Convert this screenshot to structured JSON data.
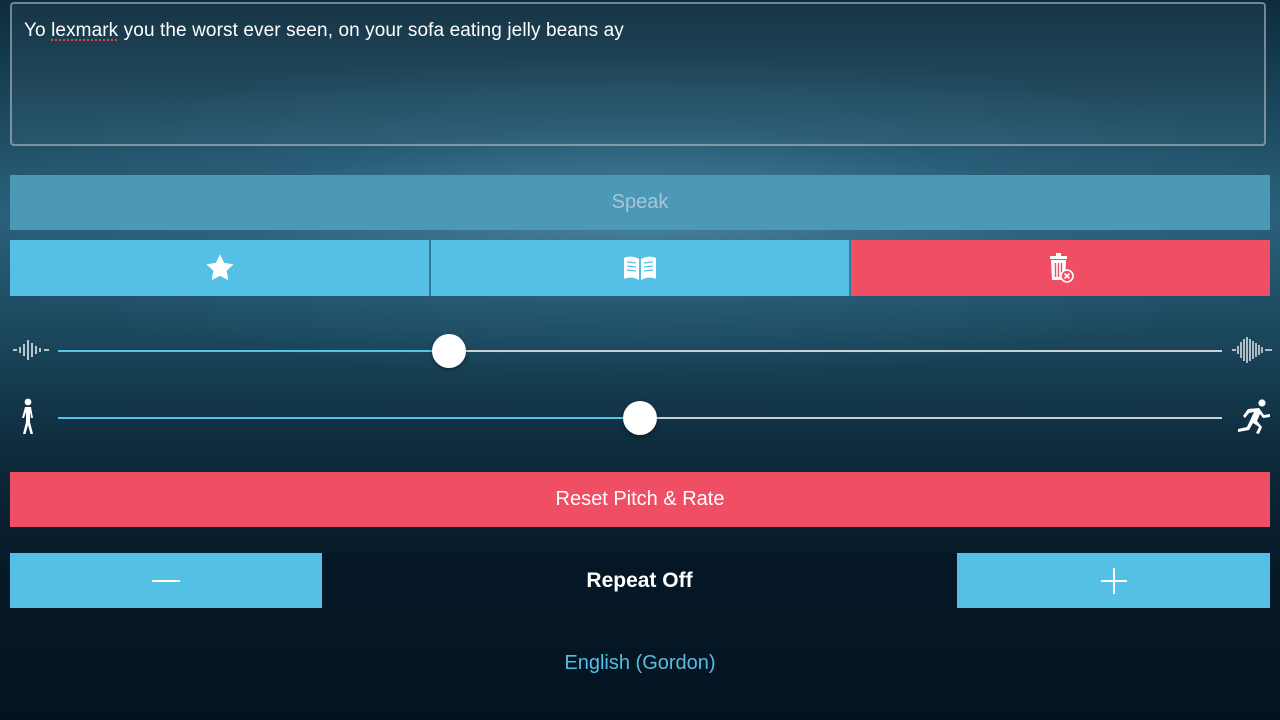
{
  "text_input": {
    "prefix": "Yo ",
    "misspelled_word": "lexmark",
    "suffix": " you the worst ever seen, on your sofa eating jelly beans ay"
  },
  "speak": {
    "label": "Speak",
    "enabled": false
  },
  "actions": [
    {
      "icon": "star-icon",
      "color": "#55c0e5"
    },
    {
      "icon": "book-icon",
      "color": "#55c0e5"
    },
    {
      "icon": "trash-clear-icon",
      "color": "#f04e64"
    }
  ],
  "pitch": {
    "value": 0.336,
    "min_icon": "low-pitch-waveform-icon",
    "max_icon": "high-pitch-waveform-icon"
  },
  "rate": {
    "value": 0.5,
    "min_icon": "walking-person-icon",
    "max_icon": "running-person-icon"
  },
  "reset": {
    "label": "Reset Pitch & Rate"
  },
  "repeat": {
    "label": "Repeat Off",
    "decrement_icon": "minus-icon",
    "increment_icon": "plus-icon"
  },
  "voice": {
    "label": "English (Gordon)"
  },
  "colors": {
    "accent_blue": "#55c0e5",
    "accent_red": "#f04e64",
    "speak_disabled": "#4c98b7",
    "slider_fill": "#56c4ea"
  }
}
